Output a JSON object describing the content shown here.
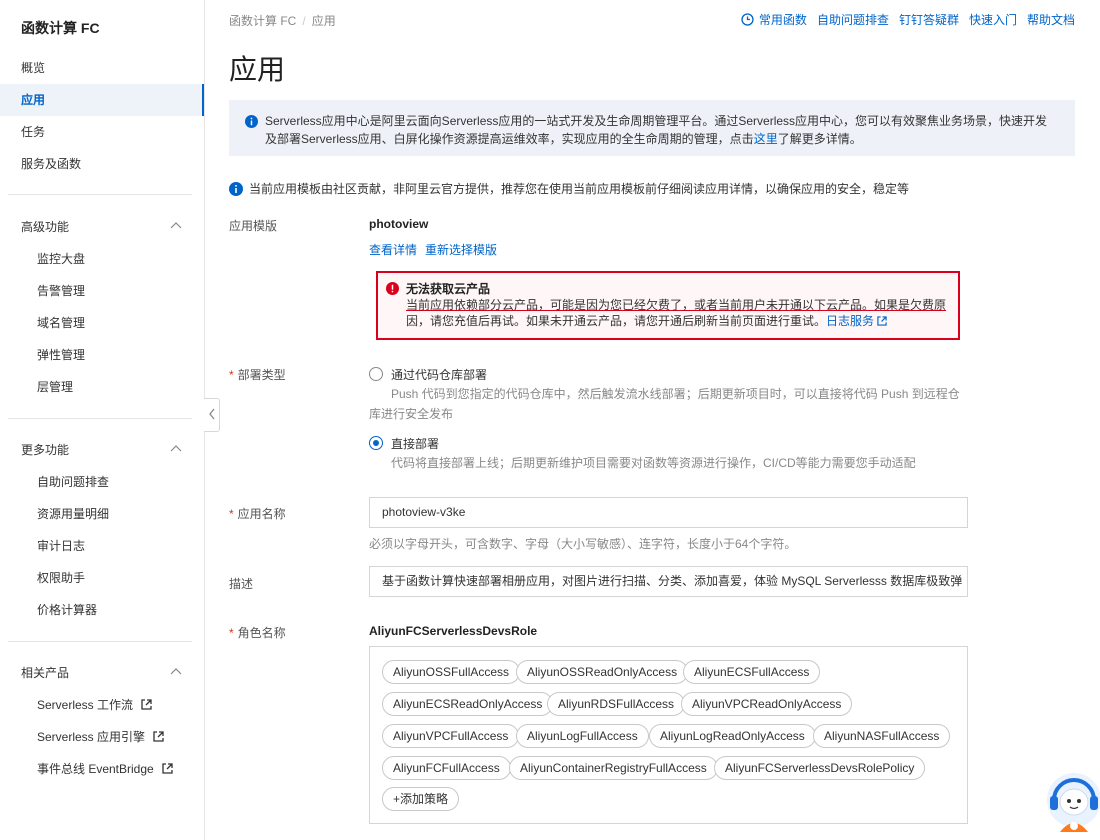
{
  "sidebar": {
    "title": "函数计算 FC",
    "nav": [
      "概览",
      "应用",
      "任务",
      "服务及函数"
    ],
    "groups": [
      {
        "label": "高级功能",
        "items": [
          "监控大盘",
          "告警管理",
          "域名管理",
          "弹性管理",
          "层管理"
        ]
      },
      {
        "label": "更多功能",
        "items": [
          "自助问题排查",
          "资源用量明细",
          "审计日志",
          "权限助手",
          "价格计算器"
        ]
      },
      {
        "label": "相关产品",
        "items": [
          "Serverless 工作流",
          "Serverless 应用引擎",
          "事件总线 EventBridge"
        ]
      }
    ]
  },
  "breadcrumb": {
    "root": "函数计算 FC",
    "sep": "/",
    "current": "应用"
  },
  "top_links": [
    "常用函数",
    "自助问题排查",
    "钉钉答疑群",
    "快速入门",
    "帮助文档"
  ],
  "page_title": "应用",
  "notice": {
    "text_before": "Serverless应用中心是阿里云面向Serverless应用的一站式开发及生命周期管理平台。通过Serverless应用中心，您可以有效聚焦业务场景，快速开发及部署Serverless应用、白屏化操作资源提高运维效率，实现应用的全生命周期的管理，点击",
    "link": "这里",
    "text_after": "了解更多详情。"
  },
  "warning": "当前应用模板由社区贡献，非阿里云官方提供，推荐您在使用当前应用模板前仔细阅读应用详情，以确保应用的安全，稳定等",
  "form": {
    "template": {
      "label": "应用模版",
      "value": "photoview",
      "link_details": "查看详情",
      "link_reselect": "重新选择模版"
    },
    "error": {
      "title": "无法获取云产品",
      "underlined": "当前应用依赖部分云产品，可能是因为您已经欠费了，或者当前用户未开通以下云产品。如果是欠费原",
      "rest": "因，请您充值后再试。如果未开通云产品，请您开通后刷新当前页面进行重试。",
      "link": "日志服务"
    },
    "deploy": {
      "label": "部署类型",
      "required_mark": "*",
      "options": [
        {
          "label": "通过代码仓库部署",
          "desc": "Push 代码到您指定的代码仓库中，然后触发流水线部署；后期更新项目时，可以直接将代码 Push 到远程仓库进行安全发布",
          "checked": false
        },
        {
          "label": "直接部署",
          "desc": "代码将直接部署上线；后期更新维护项目需要对函数等资源进行操作，CI/CD等能力需要您手动适配",
          "checked": true
        }
      ]
    },
    "app_name": {
      "label": "应用名称",
      "value": "photoview-v3ke",
      "hint": "必须以字母开头，可含数字、字母（大小写敏感）、连字符，长度小于64个字符。"
    },
    "description": {
      "label": "描述",
      "value": "基于函数计算快速部署相册应用，对图片进行扫描、分类、添加喜爱，体验 MySQL Serverlesss 数据库极致弹"
    },
    "role": {
      "label": "角色名称",
      "value": "AliyunFCServerlessDevsRole",
      "policies": [
        "AliyunOSSFullAccess",
        "AliyunOSSReadOnlyAccess",
        "AliyunECSFullAccess",
        "AliyunECSReadOnlyAccess",
        "AliyunRDSFullAccess",
        "AliyunVPCReadOnlyAccess",
        "AliyunVPCFullAccess",
        "AliyunLogFullAccess",
        "AliyunLogReadOnlyAccess",
        "AliyunNASFullAccess",
        "AliyunFCFullAccess",
        "AliyunContainerRegistryFullAccess",
        "AliyunFCServerlessDevsRolePolicy"
      ],
      "add_policy": "添加策略"
    }
  },
  "colors": {
    "primary": "#0064c8",
    "error": "#d9001b",
    "required": "#d93026"
  }
}
